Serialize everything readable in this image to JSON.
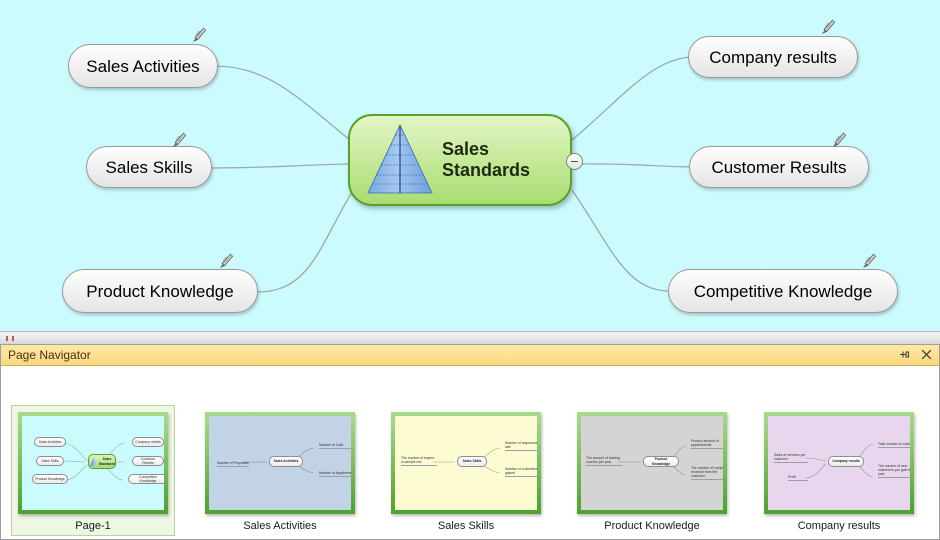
{
  "canvas": {
    "background_color": "#ccfbfd",
    "center_node": {
      "label_line1": "Sales",
      "label_line2": "Standards",
      "icon": "pyramid-icon",
      "border_color": "#5aa02c",
      "collapse_control": "minus"
    },
    "topics": [
      {
        "label": "Sales Activities",
        "side": "left",
        "marker": "hyperlink-clip-icon"
      },
      {
        "label": "Sales Skills",
        "side": "left",
        "marker": "hyperlink-clip-icon"
      },
      {
        "label": "Product Knowledge",
        "side": "left",
        "marker": "hyperlink-clip-icon"
      },
      {
        "label": "Company results",
        "side": "right",
        "marker": "hyperlink-clip-icon"
      },
      {
        "label": "Customer Results",
        "side": "right",
        "marker": "hyperlink-clip-icon"
      },
      {
        "label": "Competitive Knowledge",
        "side": "right",
        "marker": "hyperlink-clip-icon"
      }
    ]
  },
  "navigator": {
    "title": "Page Navigator",
    "pin_icon": "pin-icon",
    "close_icon": "close-icon",
    "pages": [
      {
        "caption": "Page-1",
        "selected": true,
        "page_background": "#ccfbfd",
        "center_label": "Sales Standards",
        "branches": [
          "Sales Activities",
          "Sales Skills",
          "Product Knowledge",
          "Company results",
          "Customer Results",
          "Competitive Knowledge"
        ]
      },
      {
        "caption": "Sales Activities",
        "selected": false,
        "page_background": "#c2d3e6",
        "center_label": "Sales Activities",
        "branches": [
          "Number of Proposals",
          "Number of Calls",
          "Number of Appointments"
        ]
      },
      {
        "caption": "Sales Skills",
        "selected": false,
        "page_background": "#fcfbd2",
        "center_label": "Sales Skills",
        "branches": [
          "The number of buyers in sample mix",
          "Number of responses rate",
          "Number of customers gained"
        ]
      },
      {
        "caption": "Product Knowledge",
        "selected": false,
        "page_background": "#d4d4d4",
        "center_label": "Product Knowledge",
        "branches": [
          "The amount of training courses per year",
          "Product amount of appointments",
          "The number of complaints received from the customer"
        ]
      },
      {
        "caption": "Company results",
        "selected": false,
        "page_background": "#e8d6ee",
        "center_label": "Company results",
        "branches": [
          "Sales of services per customer",
          "Profit",
          "Total number of customers",
          "The number of new customers you gain this year"
        ]
      }
    ]
  }
}
